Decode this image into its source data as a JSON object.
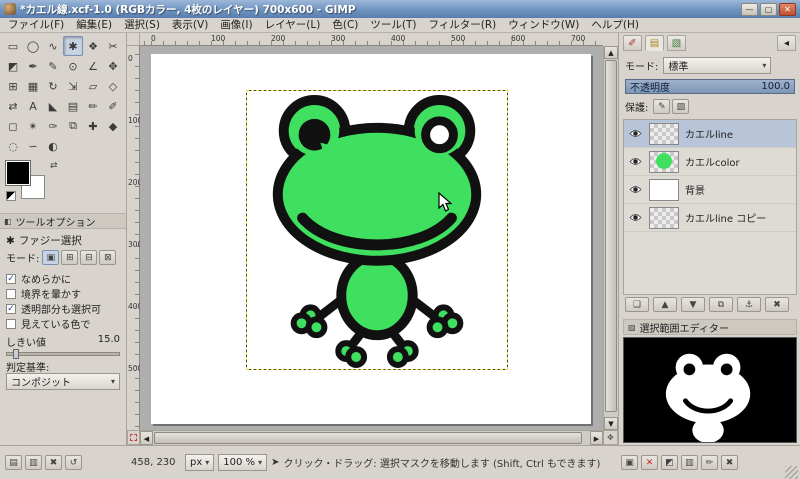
{
  "window": {
    "title": "*カエル線.xcf-1.0 (RGBカラー, 4枚のレイヤー) 700x600 - GIMP",
    "control_icons": [
      "minimize-icon",
      "maximize-icon",
      "close-icon"
    ]
  },
  "menu": {
    "items": [
      "ファイル(F)",
      "編集(E)",
      "選択(S)",
      "表示(V)",
      "画像(I)",
      "レイヤー(L)",
      "色(C)",
      "ツール(T)",
      "フィルター(R)",
      "ウィンドウ(W)",
      "ヘルプ(H)"
    ]
  },
  "toolbox": {
    "tools": [
      "rect-select",
      "ellipse-select",
      "free-select",
      "fuzzy-select",
      "select-by-color",
      "scissors-select",
      "foreground-select",
      "paths-tool",
      "color-picker",
      "zoom-tool",
      "measure-tool",
      "move-tool",
      "align-tool",
      "crop-tool",
      "rotate-tool",
      "scale-tool",
      "shear-tool",
      "perspective-tool",
      "flip-tool",
      "text-tool",
      "bucket-fill-tool",
      "blend-tool",
      "pencil-tool",
      "paintbrush-tool",
      "eraser-tool",
      "airbrush-tool",
      "ink-tool",
      "clone-tool",
      "heal-tool",
      "perspective-clone-tool",
      "blur-sharpen-tool",
      "smudge-tool",
      "dodge-burn-tool"
    ],
    "active_tool": "fuzzy-select",
    "foreground_color": "#000000",
    "background_color": "#ffffff",
    "swatch_icons": [
      "swap-colors-icon",
      "default-colors-icon"
    ]
  },
  "tool_options": {
    "panel_title": "ツールオプション",
    "tool_title": "ファジー選択",
    "mode_label": "モード:",
    "mode_icons": [
      "replace-mode-icon",
      "add-mode-icon",
      "subtract-mode-icon",
      "intersect-mode-icon"
    ],
    "checkboxes": [
      {
        "label": "なめらかに",
        "checked": true
      },
      {
        "label": "境界を暈かす",
        "checked": false
      },
      {
        "label": "透明部分も選択可",
        "checked": true
      },
      {
        "label": "見えている色で",
        "checked": false
      }
    ],
    "threshold_label": "しきい値",
    "threshold_value": "15.0",
    "criterion_label": "判定基準:",
    "criterion_value": "コンポジット",
    "footer_icons": [
      "save-options-icon",
      "restore-options-icon",
      "delete-options-icon",
      "reset-options-icon"
    ]
  },
  "rulers": {
    "h": [
      "0",
      "100",
      "200",
      "300",
      "400",
      "500",
      "600",
      "700"
    ],
    "v": [
      "0",
      "100",
      "200",
      "300",
      "400",
      "500"
    ]
  },
  "canvas": {
    "frog_green": "#3fe05f",
    "outline_color": "#111111",
    "layer_boundary_color": "#e6de4a"
  },
  "layers_panel": {
    "tab_icons": [
      "brushes-tab-icon",
      "layers-tab-icon",
      "gradients-tab-icon"
    ],
    "mode_label": "モード:",
    "mode_value": "標準",
    "opacity_label": "不透明度",
    "opacity_value": "100.0",
    "lock_label": "保護:",
    "lock_icons": [
      "lock-pixels-icon",
      "lock-alpha-icon"
    ],
    "layers": [
      {
        "name": "カエルline",
        "thumb": "checker",
        "selected": true
      },
      {
        "name": "カエルcolor",
        "thumb": "green",
        "selected": false
      },
      {
        "name": "背景",
        "thumb": "white",
        "selected": false
      },
      {
        "name": "カエルline コピー",
        "thumb": "checker",
        "selected": false
      }
    ],
    "footer_icons": [
      "new-layer-icon",
      "raise-layer-icon",
      "lower-layer-icon",
      "duplicate-layer-icon",
      "anchor-layer-icon",
      "delete-layer-icon"
    ]
  },
  "selection_editor": {
    "title": "選択範囲エディター",
    "footer_icons": [
      "select-all-icon",
      "select-none-icon",
      "invert-selection-icon",
      "save-to-channel-icon",
      "stroke-selection-icon",
      "delete-selection-icon"
    ]
  },
  "statusbar": {
    "position": "458, 230",
    "unit": "px",
    "zoom": "100 %",
    "message": "クリック・ドラッグ: 選択マスクを移動します (Shift, Ctrl もできます)"
  }
}
